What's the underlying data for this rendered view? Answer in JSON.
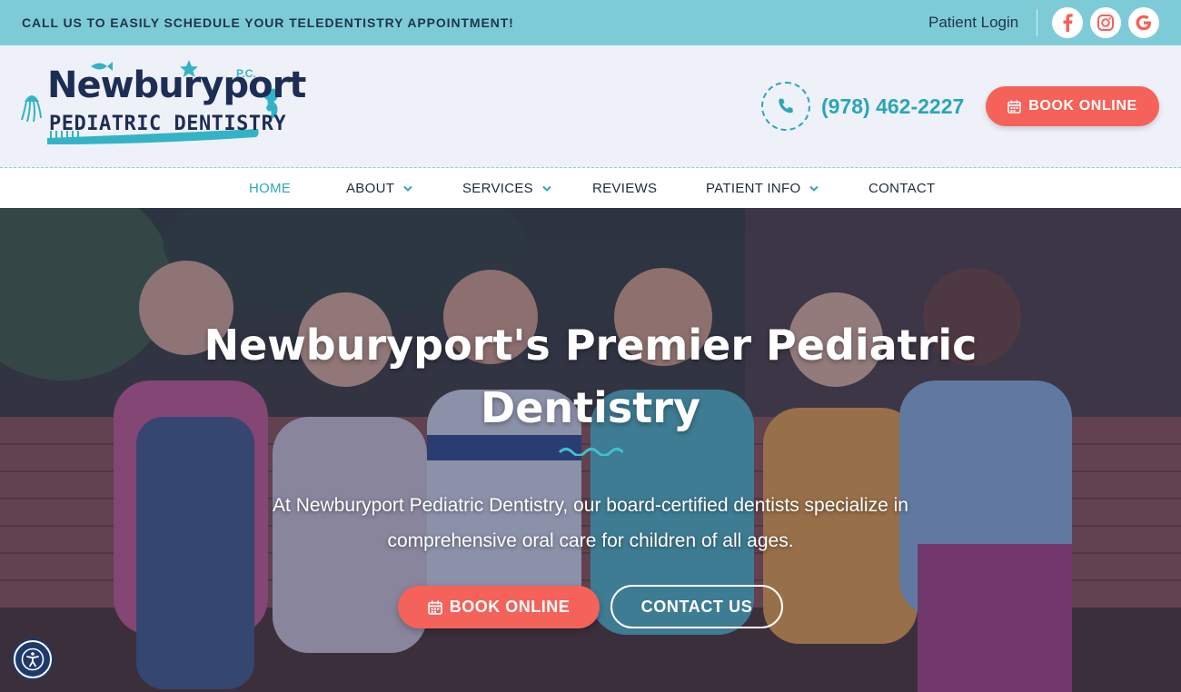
{
  "topbar": {
    "promo": "CALL US TO EASILY SCHEDULE YOUR TELEDENTISTRY APPOINTMENT!",
    "patient_login": "Patient Login",
    "social": [
      "facebook-icon",
      "instagram-icon",
      "google-icon"
    ]
  },
  "header": {
    "logo": {
      "line1": "Newburyport",
      "pc": "P.C.",
      "line2": "PEDIATRIC DENTISTRY"
    },
    "phone": "(978) 462-2227",
    "book_label": "BOOK ONLINE"
  },
  "nav": {
    "items": [
      {
        "label": "HOME",
        "active": true,
        "dropdown": false
      },
      {
        "label": "ABOUT",
        "dropdown": true
      },
      {
        "label": "SERVICES",
        "dropdown": true
      },
      {
        "label": "REVIEWS",
        "dropdown": false
      },
      {
        "label": "PATIENT INFO",
        "dropdown": true
      },
      {
        "label": "CONTACT",
        "dropdown": false
      }
    ]
  },
  "hero": {
    "title_line1": "Newburyport's Premier Pediatric",
    "title_line2": "Dentistry",
    "subtitle_line1": "At Newburyport Pediatric Dentistry, our board-certified dentists specialize in",
    "subtitle_line2": "comprehensive oral care for children of all ages.",
    "book_label": "BOOK ONLINE",
    "contact_label": "CONTACT US"
  },
  "colors": {
    "topbar": "#7ecbd8",
    "accent_teal": "#2fa6b8",
    "cta_coral": "#f4625a",
    "navy": "#1e2d55"
  }
}
